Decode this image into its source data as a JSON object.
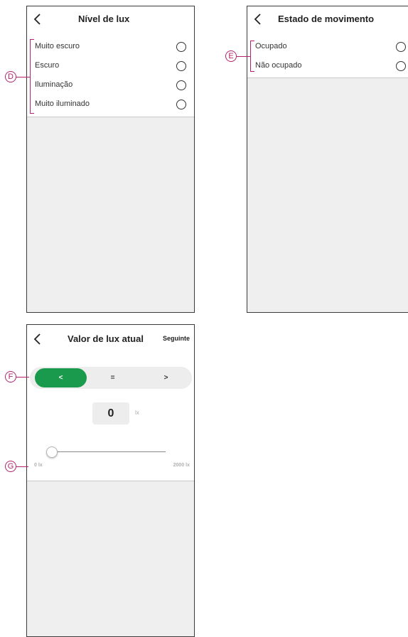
{
  "screen_lux_level": {
    "title": "Nível de lux",
    "options": [
      "Muito escuro",
      "Escuro",
      "Iluminação",
      "Muito iluminado"
    ]
  },
  "screen_motion": {
    "title": "Estado de movimento",
    "options": [
      "Ocupado",
      "Não ocupado"
    ]
  },
  "screen_lux_value": {
    "title": "Valor de lux atual",
    "next_label": "Seguinte",
    "comparators": [
      "<",
      "=",
      ">"
    ],
    "selected_comparator": "<",
    "value": "0",
    "unit": "lx",
    "slider_min_label": "0 lx",
    "slider_max_label": "2000 lx",
    "slider_fraction": 0
  },
  "callouts": {
    "d": "D",
    "e": "E",
    "f": "F",
    "g": "G"
  },
  "colors": {
    "accent_green": "#1a9a4c",
    "callout_magenta": "#b3236d"
  }
}
